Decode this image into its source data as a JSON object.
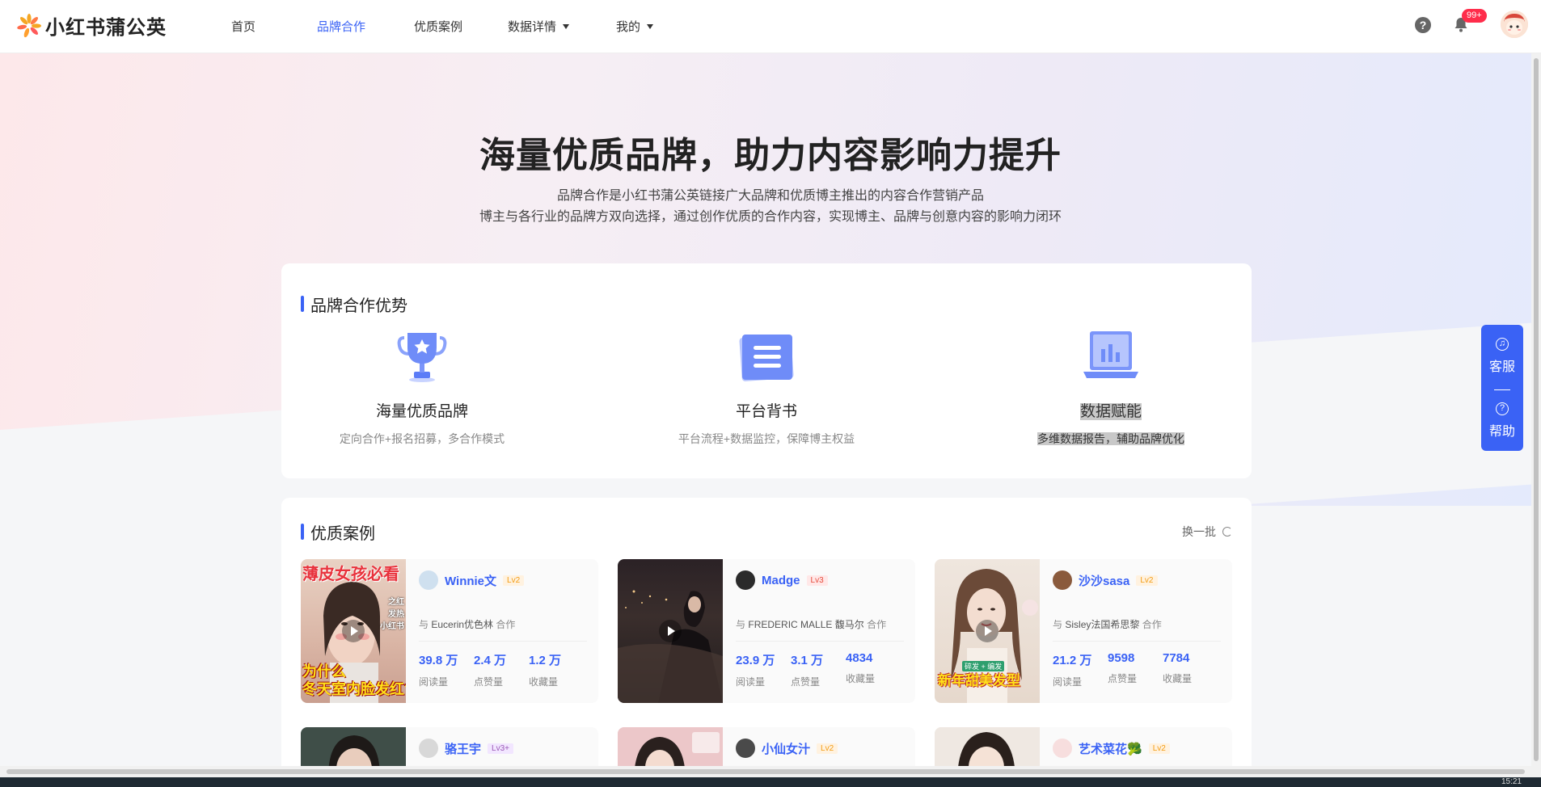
{
  "brand": {
    "name": "小红书蒲公英"
  },
  "nav": [
    {
      "label": "首页"
    },
    {
      "label": "品牌合作"
    },
    {
      "label": "优质案例"
    },
    {
      "label": "数据详情"
    },
    {
      "label": "我的"
    }
  ],
  "header": {
    "notif_badge": "99+"
  },
  "hero": {
    "title": "海量优质品牌，助力内容影响力提升",
    "line1": "品牌合作是小红书蒲公英链接广大品牌和优质博主推出的内容合作营销产品",
    "line2": "博主与各行业的品牌方双向选择，通过创作优质的合作内容，实现博主、品牌与创意内容的影响力闭环"
  },
  "advantages": {
    "title": "品牌合作优势",
    "items": [
      {
        "name": "海量优质品牌",
        "desc": "定向合作+报名招募，多合作模式",
        "icon": "trophy-icon"
      },
      {
        "name": "平台背书",
        "desc": "平台流程+数据监控，保障博主权益",
        "icon": "document-icon"
      },
      {
        "name": "数据赋能",
        "desc": "多维数据报告，辅助品牌优化",
        "icon": "laptop-chart-icon"
      }
    ]
  },
  "cases": {
    "title": "优质案例",
    "refresh_label": "换一批",
    "stat_labels": {
      "reads": "阅读量",
      "likes": "点赞量",
      "saves": "收藏量"
    },
    "collab_prefix": "与",
    "collab_suffix": "合作",
    "items": [
      {
        "name": "Winnie文",
        "level": "Lv2",
        "brand": "Eucerin优色林",
        "reads": "39.8 万",
        "likes": "2.4 万",
        "saves": "1.2 万",
        "thumb_top": "薄皮女孩必看",
        "thumb_side": "之红\n发热\n小红书",
        "thumb_bottom": "为什么\n冬天室内脸发红?"
      },
      {
        "name": "Madge",
        "level": "Lv3",
        "brand": "FREDERIC MALLE 馥马尔",
        "reads": "23.9 万",
        "likes": "3.1 万",
        "saves": "4834"
      },
      {
        "name": "沙沙sasa",
        "level": "Lv2",
        "brand": "Sisley法国希思黎",
        "reads": "21.2 万",
        "likes": "9598",
        "saves": "7784",
        "thumb_bottom": "新年甜美发型",
        "thumb_tag": "碎发 + 编发"
      },
      {
        "name": "骆王宇",
        "level": "Lv3+"
      },
      {
        "name": "小仙女汁",
        "level": "Lv2"
      },
      {
        "name": "艺术菜花🥦",
        "level": "Lv2"
      }
    ]
  },
  "float": {
    "service": "客服",
    "help": "帮助"
  },
  "taskbar": {
    "clock": "15:21"
  }
}
